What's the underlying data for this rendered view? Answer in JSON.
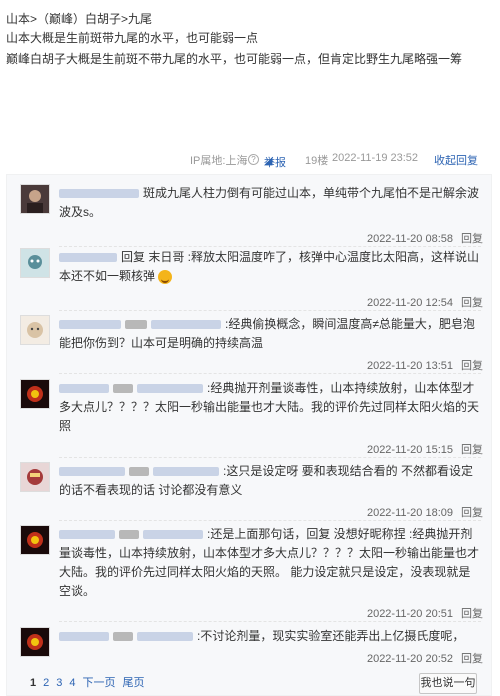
{
  "post": {
    "breadcrumb": "山本>（巅峰）白胡子>九尾",
    "line1": "山本大概是生前斑带九尾的水平，也可能弱一点",
    "line2": "巅峰白胡子大概是生前斑不带九尾的水平，也可能弱一点，但肯定比野生九尾略强一筹"
  },
  "meta": {
    "ip": "IP属地:上海",
    "help_icon": "?",
    "report": "举报",
    "floor": "19楼",
    "time": "2022-11-19 23:52",
    "collapse": "收起回复"
  },
  "replies": [
    {
      "text": "斑成九尾人柱力倒有可能过山本，单纯带个九尾怕不是卍解余波波及s。",
      "time": "2022-11-20 08:58",
      "reply_label": "回复",
      "avatar_color": "#4a3a3a"
    },
    {
      "text": "回复 末日哥 :释放太阳温度咋了，核弹中心温度比太阳高，这样说山本还不如一颗核弹",
      "time": "2022-11-20 12:54",
      "reply_label": "回复",
      "avatar_color": "#5a8f9a"
    },
    {
      "text": ":经典偷换概念，瞬间温度高≠总能量大，肥皂泡能把你伤到？山本可是明确的持续高温",
      "time": "2022-11-20 13:51",
      "reply_label": "回复",
      "avatar_color": "#d9c3a5"
    },
    {
      "text": ":经典抛开剂量谈毒性，山本持续放射，山本体型才多大点儿？？？？太阳一秒输出能量也才大陆。我的评价先过同样太阳火焰的天照",
      "time": "2022-11-20 15:15",
      "reply_label": "回复",
      "avatar_color": "#7a1a1a"
    },
    {
      "text": ":这只是设定呀 要和表现结合看的 不然都看设定的话不看表现的话 讨论都没有意义",
      "time": "2022-11-20 18:09",
      "reply_label": "回复",
      "avatar_color": "#a43a3a"
    },
    {
      "text": ":还是上面那句话，回复 没想好昵称捏 :经典抛开剂量谈毒性，山本持续放射，山本体型才多大点儿？？？？太阳一秒输出能量也才大陆。我的评价先过同样太阳火焰的天照。 能力设定就只是设定，没表现就是空谈。",
      "time": "2022-11-20 20:51",
      "reply_label": "回复",
      "avatar_color": "#7a1a1a"
    },
    {
      "text": ":不讨论剂量，现实实验室还能弄出上亿摄氏度呢，",
      "time": "2022-11-20 20:52",
      "reply_label": "回复",
      "avatar_color": "#7a1a1a"
    }
  ],
  "pager": {
    "pages": [
      "1",
      "2",
      "3",
      "4"
    ],
    "next": "下一页",
    "last": "尾页"
  },
  "say_button": "我也说一句"
}
